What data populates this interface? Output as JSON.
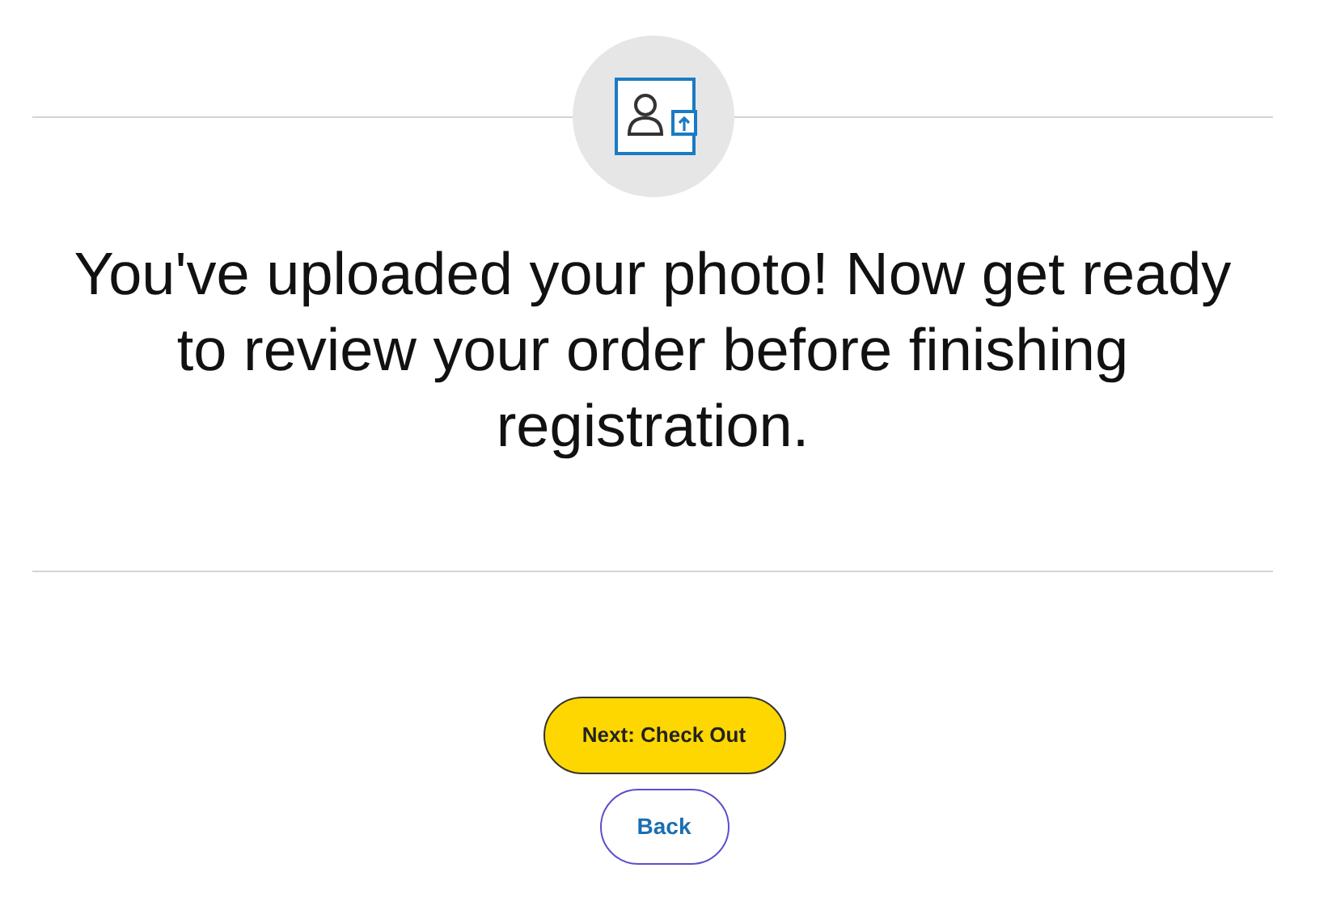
{
  "message": "You've uploaded your photo! Now get ready to review your order before finishing registration.",
  "buttons": [
    {
      "label": "Next: Check Out",
      "kind": "primary"
    },
    {
      "label": "Back",
      "kind": "secondary"
    }
  ]
}
